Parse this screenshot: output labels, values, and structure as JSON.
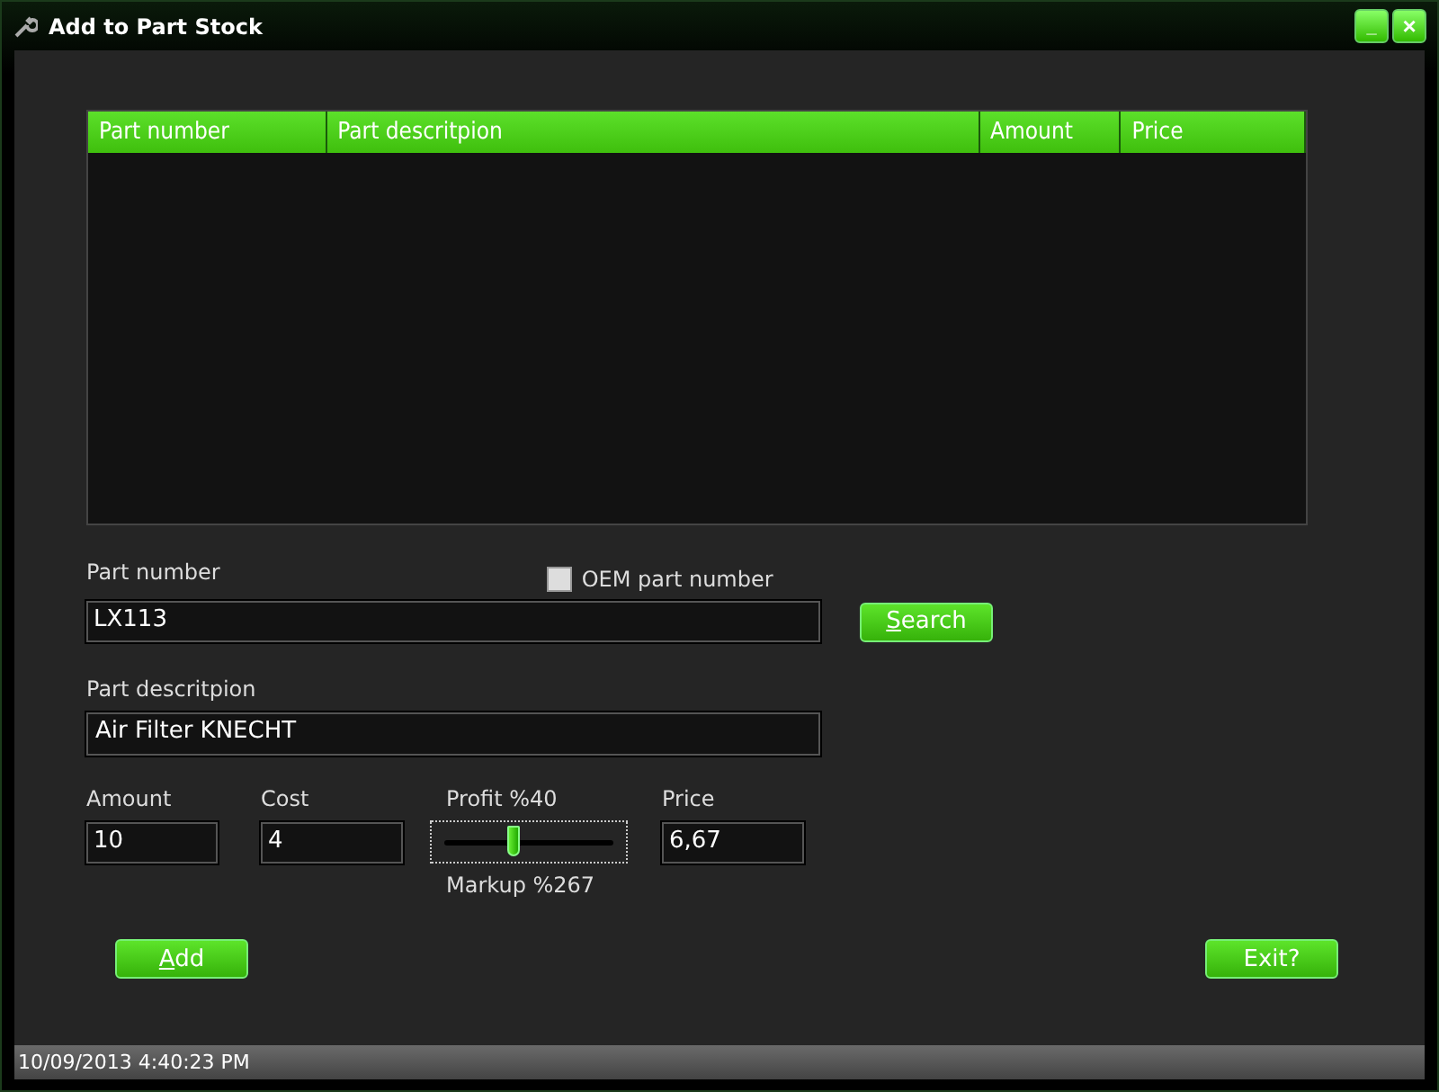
{
  "window": {
    "title": "Add to Part Stock",
    "controls": [
      {
        "kind": "minimize",
        "label": "_"
      },
      {
        "kind": "close",
        "label": "×"
      }
    ]
  },
  "table": {
    "columns": [
      "Part number",
      "Part descritpion",
      "Amount",
      "Price"
    ]
  },
  "part_number": {
    "label": "Part number",
    "value": "LX113"
  },
  "oem_part_number": {
    "label": "OEM part number",
    "checked": false
  },
  "search_button": {
    "label": "Search",
    "mnemonic": true
  },
  "part_description": {
    "label": "Part descritpion",
    "value": "Air Filter KNECHT"
  },
  "amount": {
    "label": "Amount",
    "value": "10"
  },
  "cost": {
    "label": "Cost",
    "value": "4"
  },
  "profit": {
    "label": "Profit %40",
    "level": 0.4,
    "markup": "Markup %267"
  },
  "price": {
    "label": "Price",
    "value": "6,67"
  },
  "add_button": {
    "label": "Add",
    "mnemonic": true
  },
  "exit_button": {
    "label": "Exit?",
    "mnemonic": false
  },
  "status_bar": {
    "text": "10/09/2013 4:40:23 PM"
  }
}
